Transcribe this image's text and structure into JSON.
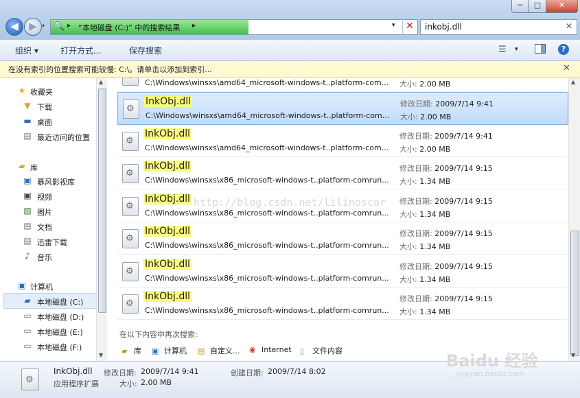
{
  "window": {
    "minimize": "─",
    "maximize": "□",
    "close": "✕"
  },
  "nav": {
    "back_icon": "back-arrow-icon",
    "forward_icon": "forward-arrow-icon",
    "back_glyph": "◀",
    "forward_glyph": "▶",
    "history_glyph": "▾"
  },
  "address": {
    "text": "“本地磁盘 (C:)” 中的搜索结果",
    "sep": "▸",
    "drop": "▾",
    "clear": "✕",
    "icon": "🔍"
  },
  "search": {
    "value": "inkobj.dll",
    "clear": "✕"
  },
  "toolbar": {
    "organize": "组织 ▾",
    "open_with": "打开方式...",
    "save_search": "保存搜索",
    "views": "☰",
    "views_drop": "▾",
    "help": "?"
  },
  "infobar": {
    "text": "在没有索引的位置搜索可能较慢: C:\\。请单击以添加到索引...",
    "close": "✕"
  },
  "sidebar": {
    "favorites": "收藏夹",
    "downloads": "下载",
    "desktop": "桌面",
    "recent": "最近访问的位置",
    "libraries": "库",
    "storm": "暴风影视库",
    "videos": "视频",
    "pictures": "图片",
    "documents": "文档",
    "thunder": "迅雷下载",
    "music": "音乐",
    "computer": "计算机",
    "drive_c": "本地磁盘 (C:)",
    "drive_d": "本地磁盘 (D:)",
    "drive_e": "本地磁盘 (E:)",
    "drive_f": "本地磁盘 (F:)"
  },
  "results": {
    "partial": {
      "path": "C:\\Windows\\winsxs\\amd64_microsoft-windows-t..platform-com...",
      "size_label": "大小:",
      "size": "2.00 MB"
    },
    "items": [
      {
        "name": "InkObj.dll",
        "path": "C:\\Windows\\winsxs\\amd64_microsoft-windows-t..platform-com...",
        "date_label": "修改日期:",
        "date": "2009/7/14 9:41",
        "size_label": "大小:",
        "size": "2.00 MB"
      },
      {
        "name": "InkObj.dll",
        "path": "C:\\Windows\\winsxs\\amd64_microsoft-windows-t..platform-com...",
        "date_label": "修改日期:",
        "date": "2009/7/14 9:41",
        "size_label": "大小:",
        "size": "2.00 MB"
      },
      {
        "name": "InkObj.dll",
        "path": "C:\\Windows\\winsxs\\x86_microsoft-windows-t..platform-comrun...",
        "date_label": "修改日期:",
        "date": "2009/7/14 9:15",
        "size_label": "大小:",
        "size": "1.34 MB"
      },
      {
        "name": "InkObj.dll",
        "path": "C:\\Windows\\winsxs\\x86_microsoft-windows-t..platform-comrun...",
        "date_label": "修改日期:",
        "date": "2009/7/14 9:15",
        "size_label": "大小:",
        "size": "1.34 MB"
      },
      {
        "name": "InkObj.dll",
        "path": "C:\\Windows\\winsxs\\x86_microsoft-windows-t..platform-comrun...",
        "date_label": "修改日期:",
        "date": "2009/7/14 9:15",
        "size_label": "大小:",
        "size": "1.34 MB"
      },
      {
        "name": "InkObj.dll",
        "path": "C:\\Windows\\winsxs\\x86_microsoft-windows-t..platform-comrun...",
        "date_label": "修改日期:",
        "date": "2009/7/14 9:15",
        "size_label": "大小:",
        "size": "1.34 MB"
      },
      {
        "name": "InkObj.dll",
        "path": "C:\\Windows\\winsxs\\x86_microsoft-windows-t..platform-comrun...",
        "date_label": "修改日期:",
        "date": "2009/7/14 9:15",
        "size_label": "大小:",
        "size": "1.34 MB"
      }
    ],
    "search_again_label": "在以下内容中再次搜索:",
    "search_again": [
      "库",
      "计算机",
      "自定义...",
      "Internet",
      "文件内容"
    ]
  },
  "details": {
    "name": "InkObj.dll",
    "type": "应用程序扩展",
    "modified_label": "修改日期:",
    "modified": "2009/7/14 9:41",
    "size_label": "大小:",
    "size": "2.00 MB",
    "created_label": "创建日期:",
    "created": "2009/7/14 8:02"
  },
  "watermark": "http://blog.csdn.net/lilinoscar",
  "baidu": {
    "logo": "Baidu 经验",
    "url": "jingyan.baidu.com"
  }
}
